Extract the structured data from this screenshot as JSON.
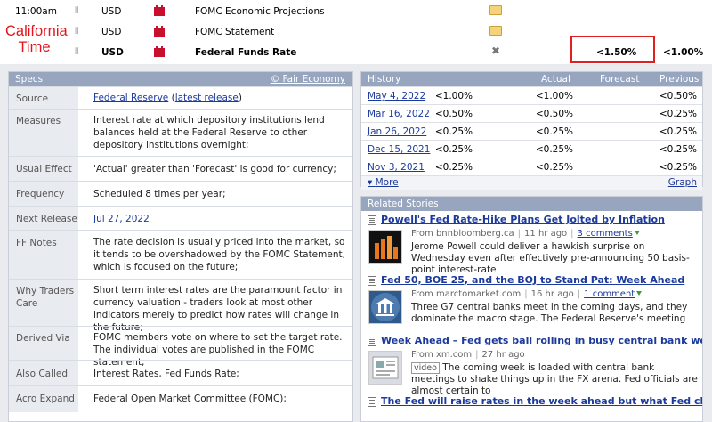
{
  "annotation": {
    "label_line1": "California",
    "label_line2": "Time"
  },
  "calendar": [
    {
      "time": "11:00am",
      "currency": "USD",
      "title": "FOMC Economic Projections",
      "detail": "folder",
      "forecast": "",
      "previous": ""
    },
    {
      "time": "",
      "currency": "USD",
      "title": "FOMC Statement",
      "detail": "folder",
      "forecast": "",
      "previous": ""
    },
    {
      "time": "",
      "currency": "USD",
      "title": "Federal Funds Rate",
      "detail": "close",
      "forecast": "<1.50%",
      "previous": "<1.00%"
    }
  ],
  "specs": {
    "header": "Specs",
    "source_link": "© Fair Economy",
    "rows": {
      "source": {
        "label": "Source",
        "link": "Federal Reserve",
        "open": " (",
        "extra_link": "latest release",
        "close": ")"
      },
      "measures": {
        "label": "Measures",
        "value": "Interest rate at which depository institutions lend balances held at the Federal Reserve to other depository institutions overnight;"
      },
      "usual_effect": {
        "label": "Usual Effect",
        "value": "'Actual' greater than 'Forecast' is good for currency;"
      },
      "frequency": {
        "label": "Frequency",
        "value": "Scheduled 8 times per year;"
      },
      "next_release": {
        "label": "Next Release",
        "value": "Jul 27, 2022"
      },
      "ff_notes": {
        "label": "FF Notes",
        "value": "The rate decision is usually priced into the market, so it tends to be overshadowed by the FOMC Statement, which is focused on the future;"
      },
      "why_traders_care": {
        "label": "Why Traders Care",
        "value": "Short term interest rates are the paramount factor in currency valuation - traders look at most other indicators merely to predict how rates will change in the future;"
      },
      "derived_via": {
        "label": "Derived Via",
        "value": "FOMC members vote on where to set the target rate. The individual votes are published in the FOMC statement;"
      },
      "also_called": {
        "label": "Also Called",
        "value": "Interest Rates, Fed Funds Rate;"
      },
      "acro_expand": {
        "label": "Acro Expand",
        "value": "Federal Open Market Committee (FOMC);"
      }
    }
  },
  "history": {
    "header": "History",
    "columns": {
      "actual": "Actual",
      "forecast": "Forecast",
      "previous": "Previous"
    },
    "rows": [
      {
        "date": "May 4, 2022",
        "actual": "<1.00%",
        "forecast": "<1.00%",
        "previous": "<0.50%"
      },
      {
        "date": "Mar 16, 2022",
        "actual": "<0.50%",
        "forecast": "<0.50%",
        "previous": "<0.25%"
      },
      {
        "date": "Jan 26, 2022",
        "actual": "<0.25%",
        "forecast": "<0.25%",
        "previous": "<0.25%"
      },
      {
        "date": "Dec 15, 2021",
        "actual": "<0.25%",
        "forecast": "<0.25%",
        "previous": "<0.25%"
      },
      {
        "date": "Nov 3, 2021",
        "actual": "<0.25%",
        "forecast": "<0.25%",
        "previous": "<0.25%"
      }
    ],
    "more_label": "More",
    "graph_label": "Graph"
  },
  "related": {
    "header": "Related Stories",
    "stories": [
      {
        "title": "Powell's Fed Rate-Hike Plans Get Jolted by Inflation",
        "from": "From bnnbloomberg.ca",
        "age": "11 hr ago",
        "comments": "3 comments",
        "text": "Jerome Powell could deliver a hawkish surprise on Wednesday even after effectively pre-announcing 50 basis-point interest-rate"
      },
      {
        "title": "Fed 50, BOE 25, and the BOJ to Stand Pat: Week Ahead",
        "from": "From marctomarket.com",
        "age": "16 hr ago",
        "comments": "1 comment",
        "text": "Three G7 central banks meet in the coming days, and they dominate the macro stage. The Federal Reserve's meeting"
      },
      {
        "title": "Week Ahead – Fed gets ball rolling in busy central bank week",
        "from": "From xm.com",
        "age": "27 hr ago",
        "badge": "video",
        "text": "The coming week is loaded with central bank meetings to shake things up in the FX arena. Fed officials are almost certain to"
      },
      {
        "title": "The Fed will raise rates in the week ahead but what Fed chief Powell"
      }
    ]
  }
}
